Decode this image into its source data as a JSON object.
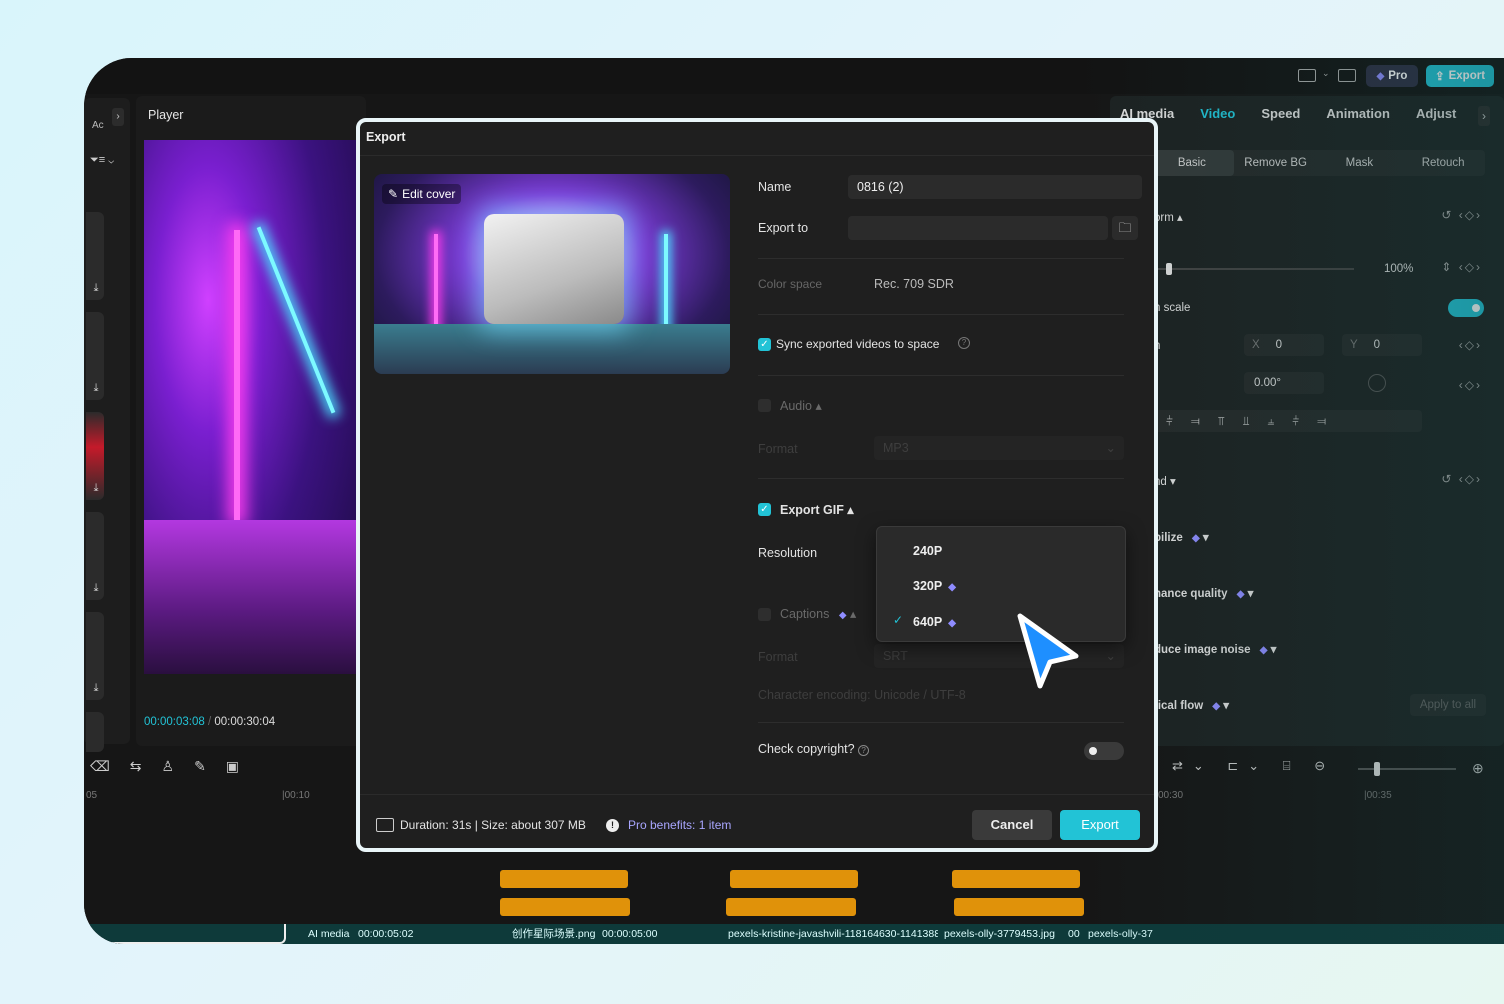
{
  "topbar": {
    "pro_label": "Pro",
    "export_label": "Export"
  },
  "left_panel": {
    "label": "Ac"
  },
  "player": {
    "title": "Player",
    "current_time": "00:00:03:08",
    "separator": "/",
    "total_time": "00:00:30:04"
  },
  "right_panel": {
    "tabs": [
      "AI media",
      "Video",
      "Speed",
      "Animation",
      "Adjust"
    ],
    "active_tab": "Video",
    "subtabs": [
      "Basic",
      "Remove BG",
      "Mask",
      "Retouch"
    ],
    "transform_label": "orm",
    "scale_value": "100%",
    "uniform_scale_label": "n scale",
    "position_label": "n",
    "x_label": "X",
    "x_value": "0",
    "y_label": "Y",
    "y_value": "0",
    "rotation_value": "0.00°",
    "blend_label": "nd",
    "stabilize_label": "bilize",
    "enhance_label": "nance quality",
    "noise_label": "duce image noise",
    "optical_label": "tical flow",
    "apply_all": "Apply to all"
  },
  "timeline": {
    "ticks": [
      "05",
      "00:10",
      "00:30",
      "00:35"
    ],
    "track_items": [
      "AI media",
      "00:00:05:02",
      "创作星际场景.png",
      "00:00:05:00",
      "pexels-kristine-javashvili-118164630-1141388",
      "pexels-olly-3779453.jpg",
      "00",
      "pexels-olly-37"
    ]
  },
  "dialog": {
    "title": "Export",
    "edit_cover": "Edit cover",
    "name_label": "Name",
    "name_value": "0816 (2)",
    "export_to_label": "Export to",
    "export_to_value": "",
    "color_space_label": "Color space",
    "color_space_value": "Rec. 709 SDR",
    "sync_label": "Sync exported videos to space",
    "audio_label": "Audio",
    "audio_format_label": "Format",
    "audio_format_value": "MP3",
    "gif_label": "Export GIF",
    "resolution_label": "Resolution",
    "resolution_options": [
      "240P",
      "320P",
      "640P"
    ],
    "resolution_selected": "640P",
    "captions_label": "Captions",
    "captions_format_label": "Format",
    "captions_format_value": "SRT",
    "encoding_label": "Character encoding:",
    "encoding_value": "Unicode / UTF-8",
    "copyright_label": "Check copyright?",
    "footer_info": "Duration: 31s | Size: about 307 MB",
    "pro_benefits": "Pro benefits: 1 item",
    "cancel_label": "Cancel",
    "export_label": "Export"
  },
  "colors": {
    "accent": "#22c3d6",
    "pro": "#8f8cff",
    "clip": "#e0920a"
  }
}
